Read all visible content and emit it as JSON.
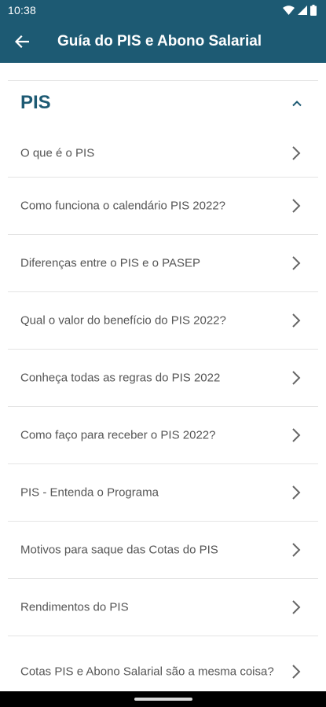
{
  "status_bar": {
    "time": "10:38",
    "icons": [
      "wifi-icon",
      "cellular-signal-icon",
      "battery-icon"
    ]
  },
  "app_bar": {
    "title": "Guía do PIS e Abono Salarial",
    "back_icon": "arrow-left-icon"
  },
  "section": {
    "title": "PIS",
    "expanded": true,
    "items": [
      {
        "label": "O que é o PIS"
      },
      {
        "label": "Como funciona o calendário PIS 2022?"
      },
      {
        "label": "Diferenças entre o PIS e o PASEP"
      },
      {
        "label": "Qual o valor do benefício do PIS 2022?"
      },
      {
        "label": "Conheça todas as regras do PIS 2022"
      },
      {
        "label": "Como faço para receber o PIS 2022?"
      },
      {
        "label": "PIS - Entenda o Programa"
      },
      {
        "label": "Motivos para saque das Cotas do PIS"
      },
      {
        "label": "Rendimentos do PIS"
      },
      {
        "label": "Cotas PIS e Abono Salarial são a mesma coisa?"
      }
    ]
  },
  "colors": {
    "primary": "#1d5a73",
    "text": "#555555",
    "divider": "#e4e4e4",
    "background": "#ffffff"
  }
}
